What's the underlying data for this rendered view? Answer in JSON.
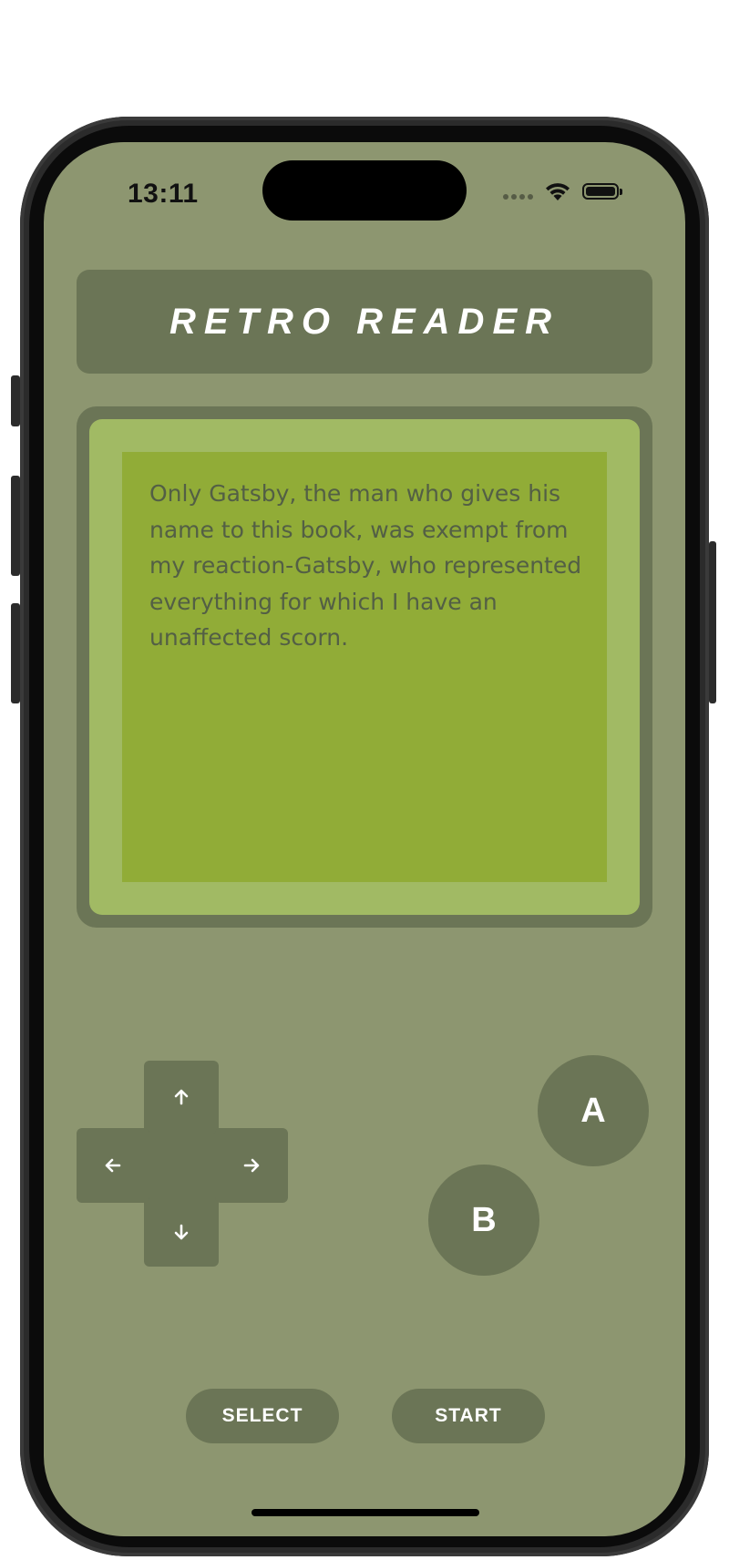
{
  "status_bar": {
    "time": "13:11"
  },
  "header": {
    "title": "RETRO READER"
  },
  "screen": {
    "text": "Only Gatsby, the man who gives his name to this book, was exempt from my reaction-Gatsby, who represented everything for which I have an unaffected scorn."
  },
  "dpad": {
    "up": "up-arrow",
    "down": "down-arrow",
    "left": "left-arrow",
    "right": "right-arrow"
  },
  "buttons": {
    "a": "A",
    "b": "B",
    "select": "SELECT",
    "start": "START"
  },
  "colors": {
    "body": "#8d9670",
    "control": "#6b7556",
    "lcd_bezel": "#a1ba64",
    "lcd": "#91ac37",
    "lcd_text": "#535f45"
  }
}
